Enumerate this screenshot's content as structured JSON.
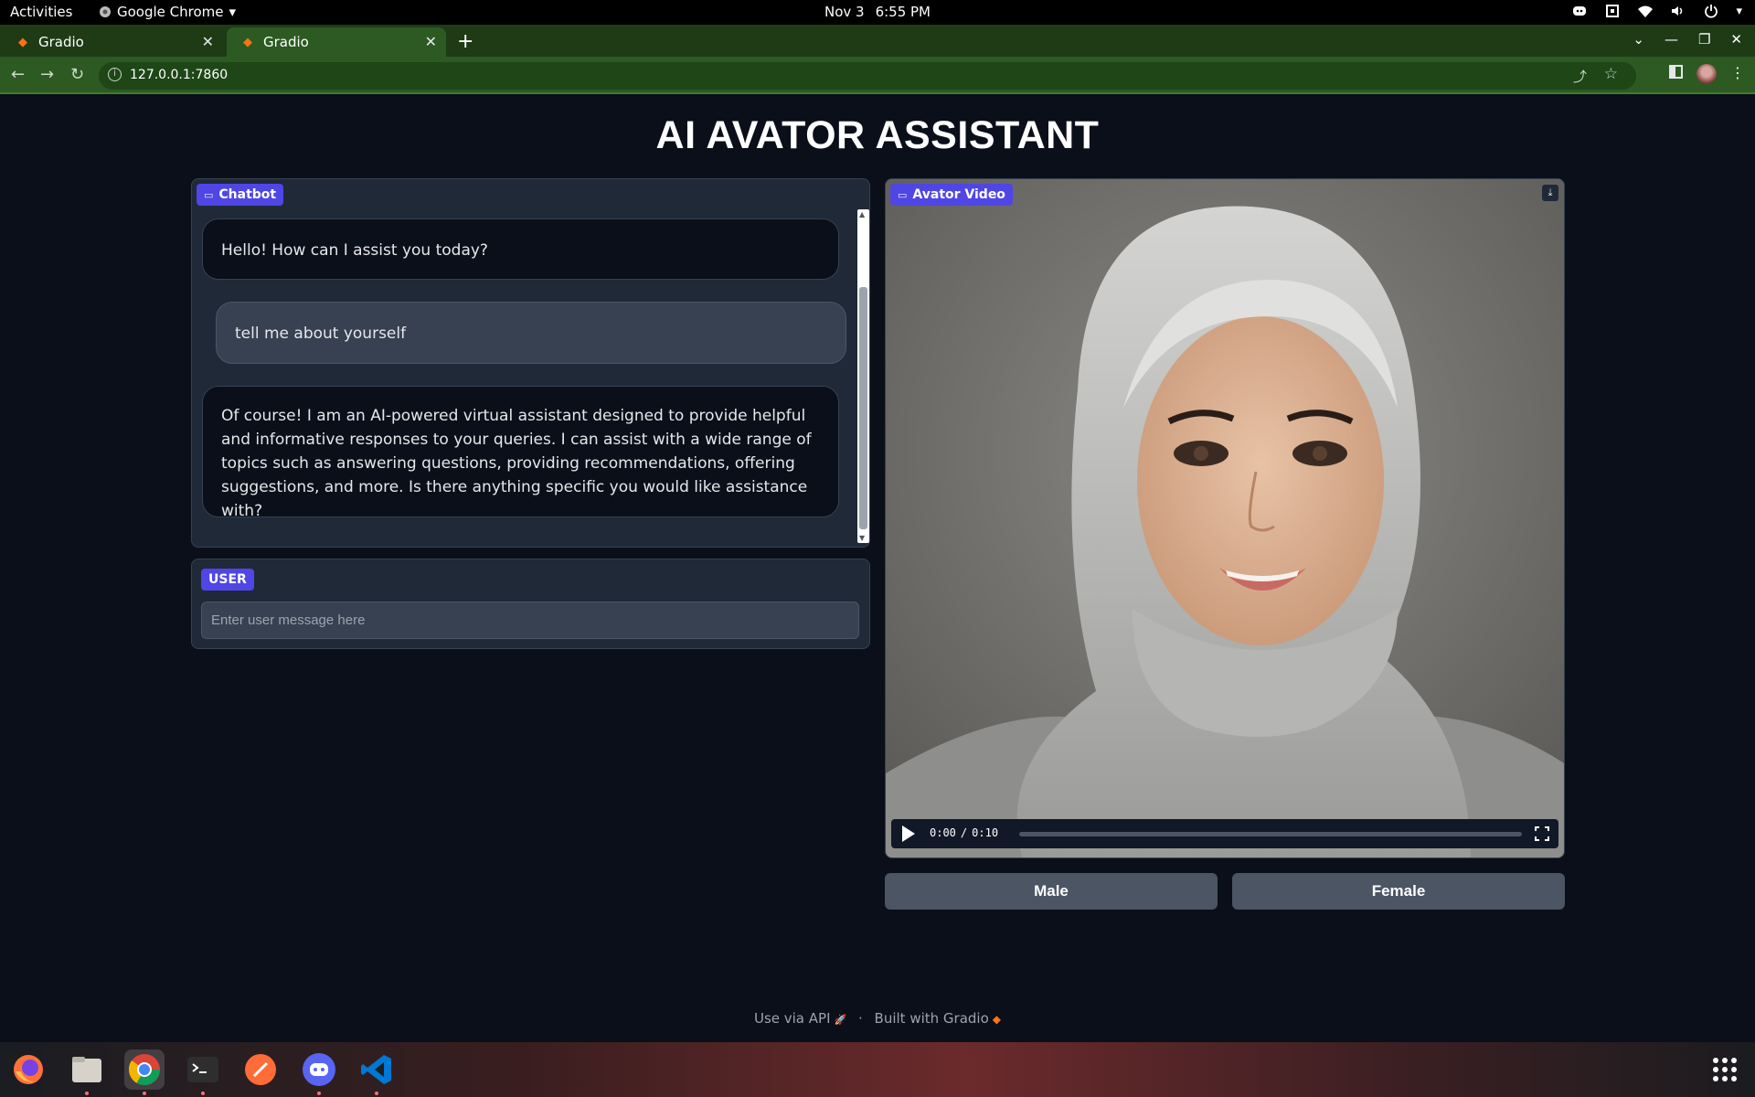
{
  "system_bar": {
    "activities": "Activities",
    "app_name": "Google Chrome",
    "date": "Nov 3",
    "time": "6:55 PM"
  },
  "browser": {
    "tabs": [
      {
        "title": "Gradio"
      },
      {
        "title": "Gradio"
      }
    ],
    "url": "127.0.0.1:7860"
  },
  "app": {
    "title": "AI AVATOR ASSISTANT",
    "chatbot": {
      "label": "Chatbot",
      "messages": [
        {
          "role": "bot",
          "text": "Hello! How can I assist you today?"
        },
        {
          "role": "user",
          "text": "tell me about yourself"
        },
        {
          "role": "bot",
          "text": "Of course! I am an AI-powered virtual assistant designed to provide helpful and informative responses to your queries. I can assist with a wide range of topics such as answering questions, providing recommendations, offering suggestions, and more. Is there anything specific you would like assistance with?"
        }
      ]
    },
    "user_box": {
      "label": "USER",
      "placeholder": "Enter user message here"
    },
    "video": {
      "label": "Avator Video",
      "current_time": "0:00",
      "duration": "0:10",
      "progress": 0
    },
    "buttons": {
      "male": "Male",
      "female": "Female"
    },
    "footer": {
      "api": "Use via API",
      "built": "Built with Gradio"
    }
  },
  "colors": {
    "background": "#0b0f19",
    "panel": "#1f2937",
    "accent": "#4f46e5",
    "button": "#4b5563",
    "chrome_theme": "#2c5a22"
  },
  "dock": {
    "apps": [
      "firefox-icon",
      "files-icon",
      "chrome-icon",
      "terminal-icon",
      "postman-icon",
      "discord-icon",
      "vscode-icon"
    ]
  }
}
